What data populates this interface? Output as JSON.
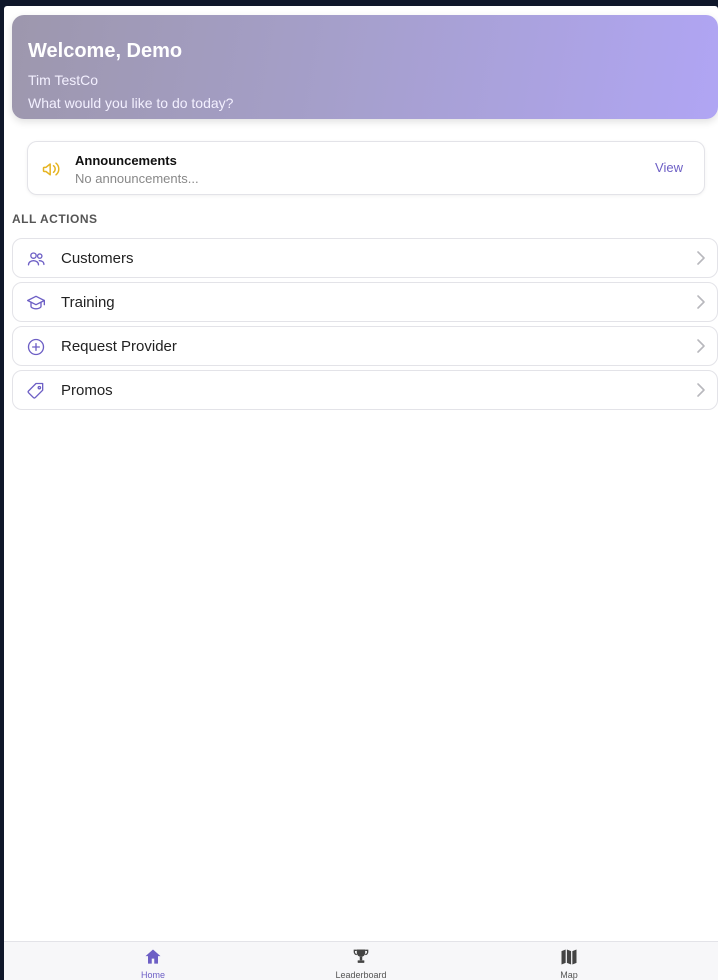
{
  "header": {
    "welcome": "Welcome, Demo",
    "company": "Tim TestCo",
    "prompt": "What would you like to do today?"
  },
  "announcements": {
    "title": "Announcements",
    "subtitle": "No announcements...",
    "action_label": "View",
    "icon": "megaphone-icon"
  },
  "actions": {
    "section_label": "ALL ACTIONS",
    "items": [
      {
        "label": "Customers",
        "icon": "users-icon"
      },
      {
        "label": "Training",
        "icon": "graduation-cap-icon"
      },
      {
        "label": "Request Provider",
        "icon": "plus-circle-icon"
      },
      {
        "label": "Promos",
        "icon": "tag-icon"
      }
    ]
  },
  "tabbar": {
    "tabs": [
      {
        "label": "Home",
        "icon": "home-icon",
        "active": true
      },
      {
        "label": "Leaderboard",
        "icon": "trophy-icon",
        "active": false
      },
      {
        "label": "Map",
        "icon": "map-icon",
        "active": false
      }
    ]
  },
  "colors": {
    "accent": "#6d5fc5",
    "announcement_icon": "#e6b422",
    "icon_stroke": "#6d5fc5",
    "tab_inactive": "#555555"
  }
}
